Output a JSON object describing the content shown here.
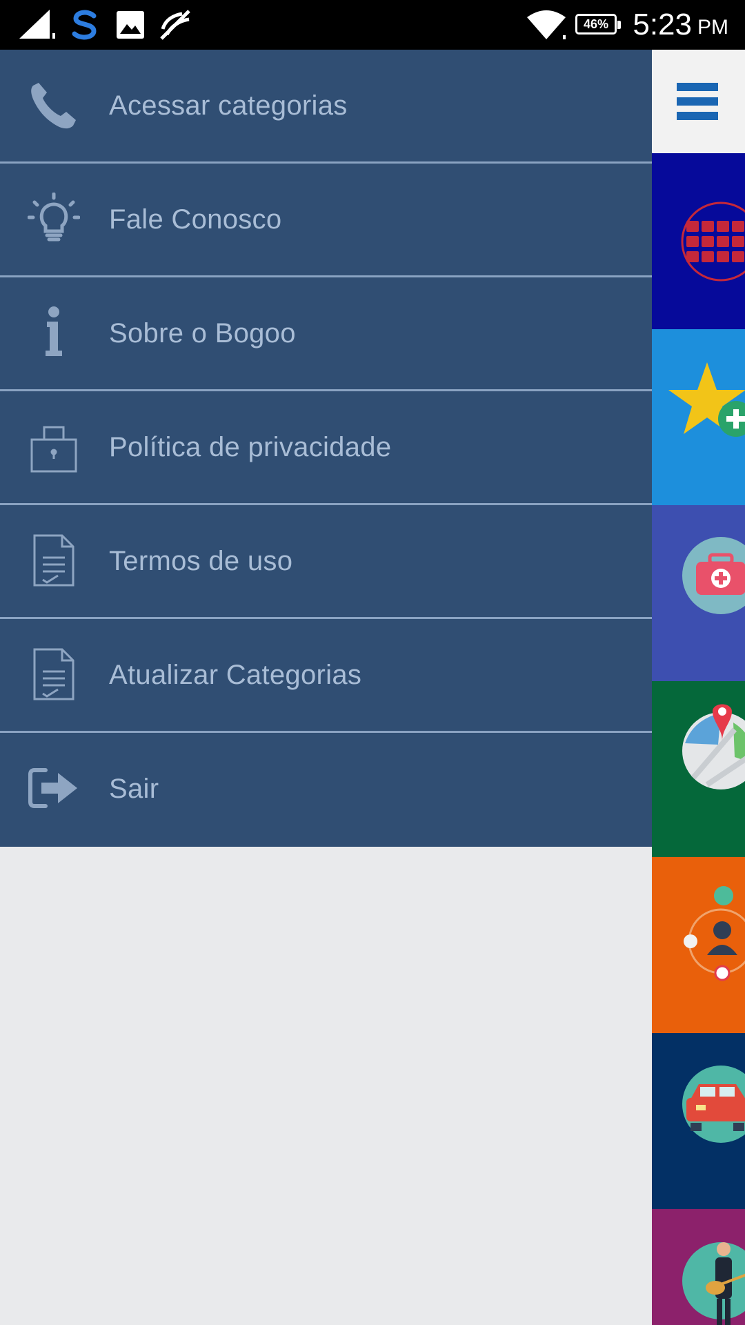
{
  "status_bar": {
    "time": "5:23",
    "ampm": "PM",
    "battery_percent": "46%",
    "icons": [
      "signal-icon",
      "app-s-icon",
      "image-icon",
      "mute-icon",
      "wifi-icon",
      "battery-icon"
    ]
  },
  "menu": {
    "items": [
      {
        "label": "Acessar categorias",
        "icon": "phone-icon"
      },
      {
        "label": "Fale Conosco",
        "icon": "lightbulb-icon"
      },
      {
        "label": "Sobre o Bogoo",
        "icon": "info-icon"
      },
      {
        "label": "Política de privacidade",
        "icon": "lock-icon"
      },
      {
        "label": "Termos de uso",
        "icon": "document-icon"
      },
      {
        "label": "Atualizar Categorias",
        "icon": "document-icon"
      },
      {
        "label": "Sair",
        "icon": "exit-icon"
      }
    ]
  },
  "app_strip": {
    "menu_icon": "hamburger-icon",
    "tiles": [
      {
        "icon": "grid-icon",
        "color": "#060a9a"
      },
      {
        "icon": "star-add-icon",
        "color": "#1d8fdc"
      },
      {
        "icon": "first-aid-icon",
        "color": "#3d4fb0"
      },
      {
        "icon": "map-pin-icon",
        "color": "#05683a"
      },
      {
        "icon": "people-network-icon",
        "color": "#e9600b"
      },
      {
        "icon": "car-icon",
        "color": "#033065"
      },
      {
        "icon": "musician-icon",
        "color": "#8c216b"
      }
    ]
  },
  "colors": {
    "drawer_bg": "#304e73",
    "divider": "#8aa3c2",
    "label": "#a9bdd6",
    "accent": "#1a66b3"
  }
}
